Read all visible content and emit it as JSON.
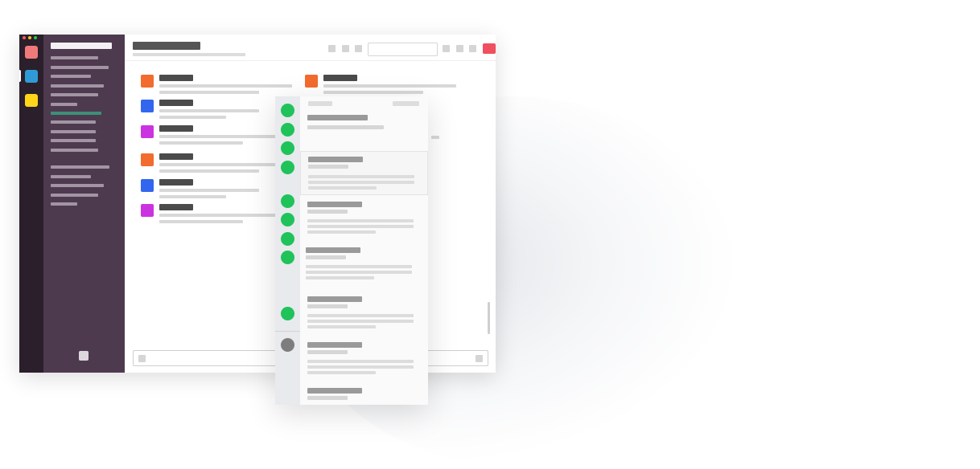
{
  "colors": {
    "rail_bg": "#2a1f2b",
    "sidebar_bg": "#4e3a4f",
    "sidebar_active_item": "#3d8f79",
    "close_button": "#ef4f5e",
    "presence_online": "#1fc35a",
    "presence_offline": "#7d7d7d"
  },
  "window_controls": [
    {
      "name": "close",
      "color": "#ef5f57"
    },
    {
      "name": "minimize",
      "color": "#f5bd2f"
    },
    {
      "name": "zoom",
      "color": "#29c840"
    }
  ],
  "workspaces": [
    {
      "color": "#f07a7a",
      "active": false
    },
    {
      "color": "#2f9bd6",
      "active": true
    },
    {
      "color": "#ffd51a",
      "active": false
    }
  ],
  "sidebar": {
    "active_item_index": 6,
    "footer_icon": "add-icon"
  },
  "header": {
    "toolbar_icons": [
      "call-icon",
      "info-icon",
      "settings-icon",
      "mention-icon",
      "star-icon",
      "more-icon"
    ],
    "search_placeholder": ""
  },
  "messages": [
    {
      "avatar_color": "#f26b2f"
    },
    {
      "avatar_color": "#f26b2f"
    },
    {
      "avatar_color": "#3366ee"
    },
    {
      "avatar_color": "#cc33e0"
    },
    {
      "avatar_color": "#f26b2f"
    },
    {
      "avatar_color": "#3366ee"
    },
    {
      "avatar_color": "#cc33e0"
    }
  ],
  "presence_list": [
    {
      "status": "online"
    },
    {
      "status": "online"
    },
    {
      "status": "online"
    },
    {
      "status": "online"
    },
    {
      "status": "online"
    },
    {
      "status": "online"
    },
    {
      "status": "online"
    },
    {
      "status": "online"
    },
    {
      "status": "online"
    },
    {
      "status": "offline"
    }
  ],
  "overlay_cards": [
    {
      "selected": false,
      "has_button": true
    },
    {
      "selected": true,
      "has_button": false
    },
    {
      "selected": false,
      "has_button": false
    },
    {
      "selected": false,
      "has_button": false
    },
    {
      "selected": false,
      "has_button": false
    },
    {
      "selected": false,
      "has_button": false
    },
    {
      "selected": false,
      "has_button": false
    }
  ]
}
